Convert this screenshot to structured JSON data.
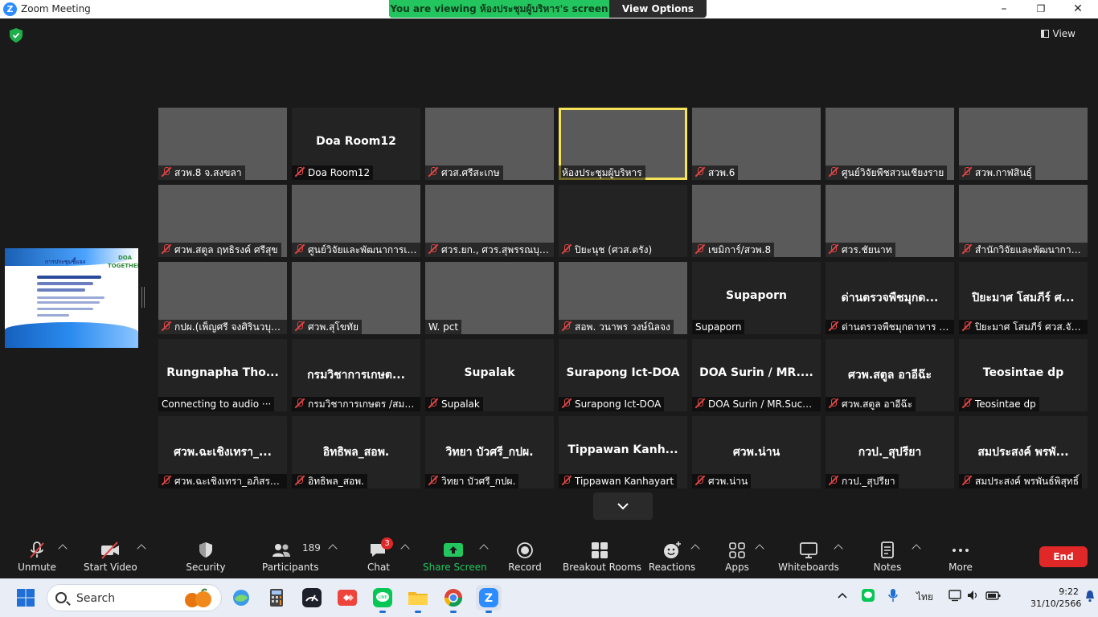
{
  "window": {
    "title": "Zoom Meeting",
    "minimize": "–",
    "maximize": "❐",
    "close": "✕"
  },
  "share_banner": {
    "message": "You are viewing ห้องประชุมผู้บริหาร's screen",
    "view_options": "View Options"
  },
  "header": {
    "view_label": "View"
  },
  "tiles": [
    {
      "label": "สวพ.8 จ.สงขลา",
      "muted": true,
      "video": true
    },
    {
      "label": "Doa Room12",
      "display": "Doa Room12",
      "muted": true,
      "video": false
    },
    {
      "label": "ศวส.ศรีสะเกษ",
      "muted": true,
      "video": true
    },
    {
      "label": "ห้องประชุมผู้บริหาร",
      "muted": false,
      "video": true,
      "active": true
    },
    {
      "label": "สวพ.6",
      "muted": true,
      "video": true
    },
    {
      "label": "ศูนย์วิจัยพืชสวนเชียงราย",
      "muted": true,
      "video": true
    },
    {
      "label": "สวพ.กาฬสินธุ์",
      "muted": true,
      "video": true
    },
    {
      "label": "ศวพ.สตูล ฤทธิรงค์ ศรีสุข",
      "muted": true,
      "video": true
    },
    {
      "label": "ศูนย์วิจัยและพัฒนาการเก...",
      "muted": true,
      "video": true
    },
    {
      "label": "ศวร.ยก., ศวร.สุพรรณบุรี,...",
      "muted": true,
      "video": true
    },
    {
      "label": "ปิยะนุช (ศวส.ตรัง)",
      "muted": true,
      "video": false,
      "blank": true
    },
    {
      "label": "เขมิการ์/สวพ.8",
      "muted": true,
      "video": true
    },
    {
      "label": "ศวร.ชัยนาท",
      "muted": true,
      "video": true
    },
    {
      "label": "สำนักวิจัยและพัฒนาการ...",
      "muted": true,
      "video": true
    },
    {
      "label": "กปผ.(เพ็ญศรี จงศิรินวบุตร)",
      "muted": true,
      "video": true
    },
    {
      "label": "ศวพ.สุโขทัย",
      "muted": true,
      "video": true
    },
    {
      "label": "W. pct",
      "muted": false,
      "video": true
    },
    {
      "label": "สอพ. วนาพร วงษ์นิลจง",
      "muted": true,
      "video": true
    },
    {
      "label": "Supaporn",
      "display": "Supaporn",
      "muted": false,
      "video": false
    },
    {
      "label": "ด่านตรวจพืชมุกดาหาร (ป...",
      "display": "ด่านตรวจพืชมุกด...",
      "muted": true,
      "video": false
    },
    {
      "label": "ปิยะมาศ โสมภีร์ ศวส.จันท...",
      "display": "ปิยะมาศ โสมภีร์ ศ...",
      "muted": true,
      "video": false
    },
    {
      "label": "Connecting to audio ···",
      "display": "Rungnapha  Tho...",
      "muted": false,
      "video": false,
      "connecting": true
    },
    {
      "label": "กรมวิชาการเกษตร /สมคิ...",
      "display": "กรมวิชาการเกษต...",
      "muted": true,
      "video": false
    },
    {
      "label": "Supalak",
      "display": "Supalak",
      "muted": true,
      "video": false
    },
    {
      "label": "Surapong Ict-DOA",
      "display": "Surapong Ict-DOA",
      "muted": true,
      "video": false
    },
    {
      "label": "DOA Surin / MR.Suchat",
      "display": "DOA Surin / MR....",
      "muted": true,
      "video": false
    },
    {
      "label": "ศวพ.สตูล อาอีฉ๊ะ",
      "display": "ศวพ.สตูล อาอีฉ๊ะ",
      "muted": true,
      "video": false
    },
    {
      "label": "Teosintae dp",
      "display": "Teosintae dp",
      "muted": true,
      "video": false
    },
    {
      "label": "ศวพ.ฉะเชิงเทรา_อภิสรา เ...",
      "display": "ศวพ.ฉะเชิงเทรา_...",
      "muted": true,
      "video": false
    },
    {
      "label": "อิทธิพล_สอพ.",
      "display": "อิทธิพล_สอพ.",
      "muted": true,
      "video": false
    },
    {
      "label": "วิทยา บัวศรี_กปผ.",
      "display": "วิทยา บัวศรี_กปผ.",
      "muted": true,
      "video": false
    },
    {
      "label": "Tippawan Kanhayart",
      "display": "Tippawan  Kanh...",
      "muted": true,
      "video": false
    },
    {
      "label": "ศวพ.น่าน",
      "display": "ศวพ.น่าน",
      "muted": true,
      "video": false
    },
    {
      "label": "กวป._สุปรียา",
      "display": "กวป._สุปรียา",
      "muted": true,
      "video": false
    },
    {
      "label": "สมประสงค์ พรพันธ์พิสุทธิ์",
      "display": "สมประสงค์ พรพั...",
      "muted": true,
      "video": false
    }
  ],
  "share_thumbnail": {
    "title": "การประชุมชี้แจง",
    "logo_text": "DOA TOGETHER"
  },
  "toolbar": {
    "unmute": "Unmute",
    "start_video": "Start Video",
    "security": "Security",
    "participants": "Participants",
    "participants_count": "189",
    "chat": "Chat",
    "chat_badge": "3",
    "share_screen": "Share Screen",
    "record": "Record",
    "breakout_rooms": "Breakout Rooms",
    "reactions": "Reactions",
    "apps": "Apps",
    "whiteboards": "Whiteboards",
    "notes": "Notes",
    "more": "More",
    "end": "End"
  },
  "taskbar": {
    "search_placeholder": "Search",
    "language": "ไทย",
    "time": "9:22",
    "date": "31/10/2566"
  },
  "colors": {
    "accent_blue": "#2d8cff",
    "banner_green": "#23c55e",
    "muted_red": "#e04545",
    "end_red": "#e02828",
    "active_speaker": "#f5e45a"
  }
}
